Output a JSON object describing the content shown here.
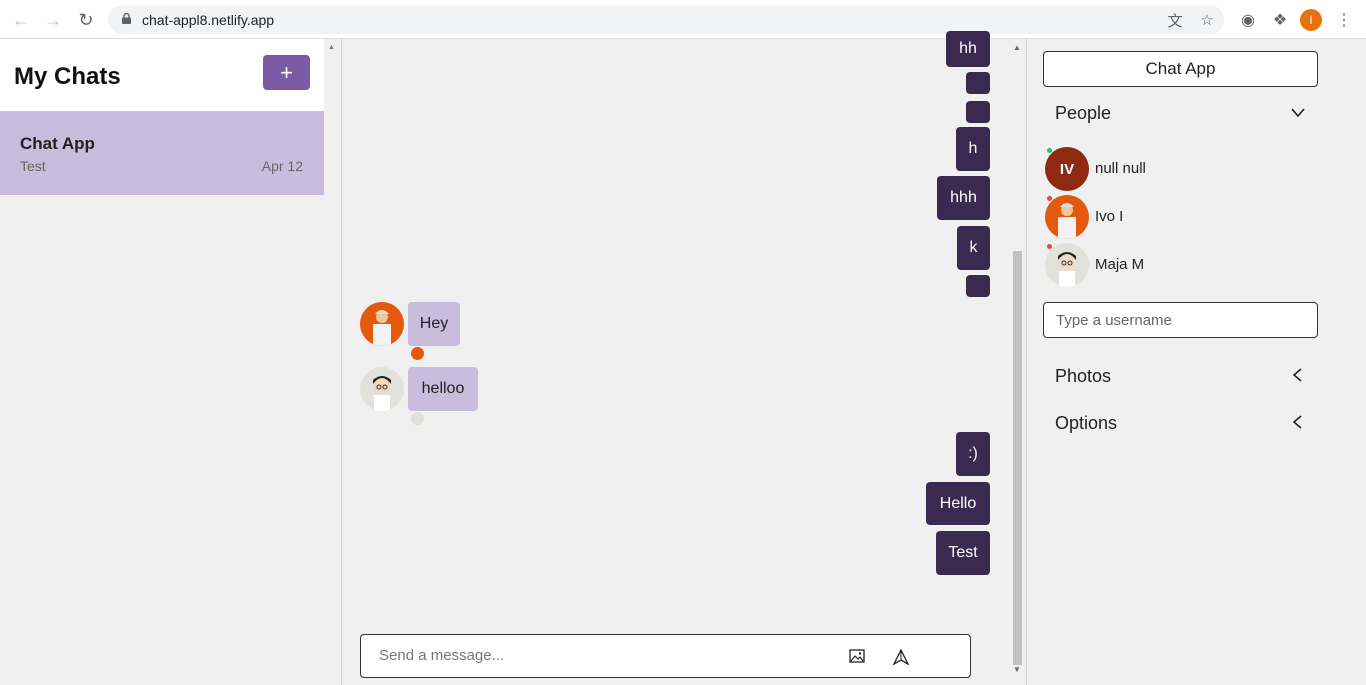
{
  "browser": {
    "url": "chat-appl8.netlify.app",
    "profile_initial": "I"
  },
  "sidebar": {
    "title": "My Chats",
    "new_chat_label": "+",
    "chats": [
      {
        "title": "Chat App",
        "last_message": "Test",
        "date": "Apr 12"
      }
    ]
  },
  "feed": {
    "messages_mine_top": [
      "hh",
      "",
      "",
      "h",
      "hhh",
      "k",
      ""
    ],
    "messages_theirs": [
      {
        "text": "Hey",
        "sender": "Ivo I"
      },
      {
        "text": "helloo",
        "sender": "Maja M"
      }
    ],
    "messages_mine_bottom": [
      ":)",
      "Hello",
      "Test"
    ],
    "input_placeholder": "Send a message..."
  },
  "details": {
    "chat_title": "Chat App",
    "people_label": "People",
    "people": [
      {
        "name": "null null",
        "initials": "IV",
        "status_color": "#22c55e"
      },
      {
        "name": "Ivo I",
        "initials": "",
        "status_color": "#ef4444"
      },
      {
        "name": "Maja M",
        "initials": "",
        "status_color": "#ef4444"
      }
    ],
    "username_placeholder": "Type a username",
    "photos_label": "Photos",
    "options_label": "Options"
  },
  "colors": {
    "accent": "#7b5aa6",
    "own_bubble": "#3b2a4f",
    "other_bubble": "#cabcdd"
  }
}
